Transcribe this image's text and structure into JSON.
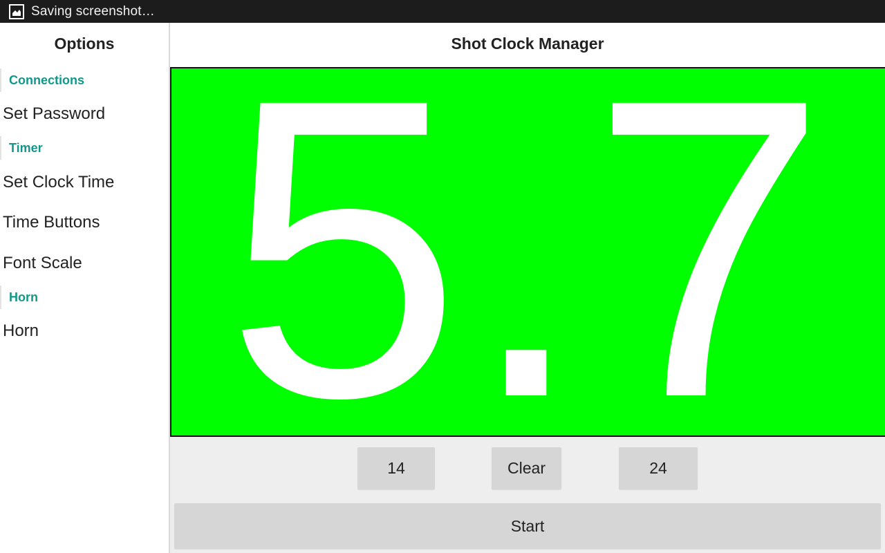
{
  "status_bar": {
    "icon": "screenshot-icon",
    "text": "Saving screenshot…"
  },
  "sidebar": {
    "title": "Options",
    "sections": [
      {
        "category": "Connections",
        "items": [
          "Set Password"
        ]
      },
      {
        "category": "Timer",
        "items": [
          "Set Clock Time",
          "Time Buttons",
          "Font Scale"
        ]
      },
      {
        "category": "Horn",
        "items": [
          "Horn"
        ]
      }
    ]
  },
  "main": {
    "title": "Shot Clock Manager",
    "clock": {
      "value": "5.7",
      "background_color": "#00ff00",
      "digit_color": "#ffffff"
    },
    "buttons": {
      "preset_14": "14",
      "clear": "Clear",
      "preset_24": "24",
      "start": "Start"
    }
  },
  "colors": {
    "category_accent": "#12988a",
    "status_bar_bg": "#1c1c1c",
    "button_bg": "#d6d6d6",
    "controls_bg": "#eeeeee"
  }
}
